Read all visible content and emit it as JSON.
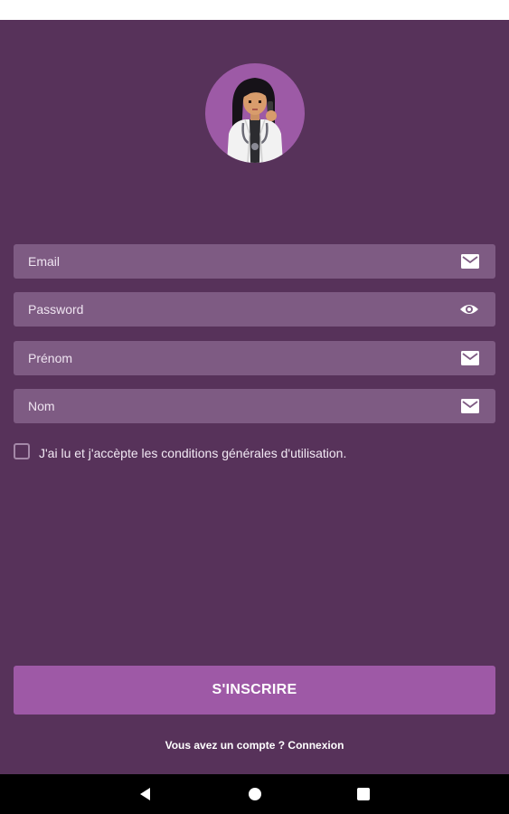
{
  "form": {
    "email_placeholder": "Email",
    "password_placeholder": "Password",
    "firstname_placeholder": "Prénom",
    "lastname_placeholder": "Nom",
    "terms_label": "J'ai lu et j'accèpte les conditions générales d'utilisation.",
    "terms_checked": false
  },
  "signup_button": {
    "label": "S'INSCRIRE"
  },
  "login_prompt": {
    "text": "Vous avez un compte ? Connexion"
  },
  "icons": {
    "email": "mail-icon",
    "password": "eye-icon",
    "firstname": "mail-icon",
    "lastname": "mail-icon",
    "nav_back": "back-triangle-icon",
    "nav_home": "home-circle-icon",
    "nav_recents": "recents-square-icon"
  },
  "colors": {
    "background": "#57325a",
    "field": "#7e5b83",
    "button": "#9e59a6",
    "avatar_circle": "#9d5aa6"
  }
}
